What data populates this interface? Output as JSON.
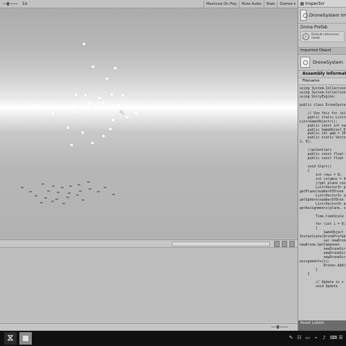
{
  "game_view": {
    "toolbar": {
      "scale_label": "1x",
      "buttons": [
        "Maximize On Play",
        "Mute Audio",
        "Stats",
        "Gizmos ▾"
      ]
    }
  },
  "inspector": {
    "tab_label": "Inspector",
    "object_name": "DroneSystem Im",
    "prefab_label": "Drone Prefab",
    "prefab_message": "Default references\nmode.",
    "imported_object_label": "Imported Object",
    "imported_name": "DroneSystem",
    "assembly_label": "Assembly Informati",
    "filename_label": "Filename",
    "code_lines": [
      "using System.Collection",
      "using System.Collection",
      "using UnityEngine;",
      "",
      "public class DroneSyster",
      "",
      "    // Use this for initializ",
      "    public static List<Gam",
      "List<GameObject>();",
      "    public const int numb",
      "    public GameObject Dr",
      "    public int gap = 10;",
      "    public static Vector3",
      "2, 0);",
      "",
      "    //potentials",
      "    public const float dron",
      "    public const float targ",
      "",
      "    void Start()",
      "    {",
      "        int rows = 8;",
      "        int columns = 4;",
      "        //get plane coordin",
      "        List<Vector3> plan",
      "getPlane(numberOfDrone",
      "        List<Vector3> sph",
      "getSphere(numberOfDron",
      "        List<Vector3> assi",
      "getAssignments(plane, s",
      "",
      "        Time.timeScale =",
      "",
      "        for (int i = 0; i < n",
      "        {",
      "            GameObject new",
      "Instantiate(DronePrefab,",
      "            var newDroneS",
      "newDrone.GetComponen",
      "            newDroneScript",
      "            newDroneScript",
      "            newDroneScript",
      "assignments[i];",
      "            Drones.Add(ne",
      "        }",
      "    }",
      "",
      "        // Update is c",
      "        void Update"
    ],
    "asset_labels": "Asset Labels"
  },
  "taskbar": {
    "apps": [
      "visual-studio",
      "unity"
    ],
    "tray_icons": [
      "pen-icon",
      "network-icon",
      "battery-icon",
      "wifi-icon",
      "volume-icon",
      "keyboard-icon",
      "notification-icon"
    ]
  }
}
